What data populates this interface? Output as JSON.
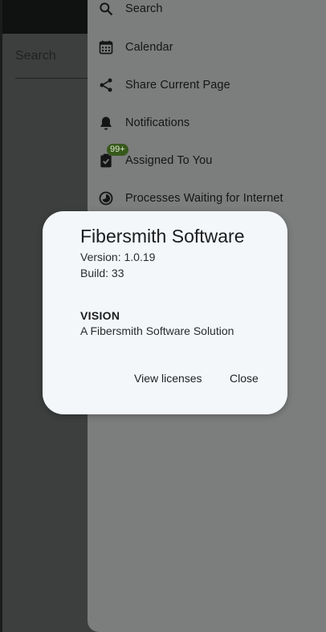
{
  "background": {
    "search_label": "Search"
  },
  "drawer": {
    "items": [
      {
        "label": "Search",
        "icon": "search-icon"
      },
      {
        "label": "Calendar",
        "icon": "calendar-icon"
      },
      {
        "label": "Share Current Page",
        "icon": "share-icon"
      },
      {
        "label": "Notifications",
        "icon": "bell-icon"
      },
      {
        "label": "Assigned To You",
        "icon": "clipboard-check-icon",
        "badge": "99+"
      },
      {
        "label": "Processes Waiting for Internet",
        "icon": "timer-icon"
      }
    ]
  },
  "dialog": {
    "title": "Fibersmith Software",
    "version": "Version: 1.0.19",
    "build": "Build: 33",
    "section_title": "VISION",
    "section_desc": "A Fibersmith Software Solution",
    "buttons": {
      "licenses": "View licenses",
      "close": "Close"
    }
  },
  "colors": {
    "scrim_dark": "#3c3f3e",
    "drawer_bg": "#7c7d7d",
    "dialog_bg": "#f3f7fa",
    "badge_bg": "#37591c"
  }
}
